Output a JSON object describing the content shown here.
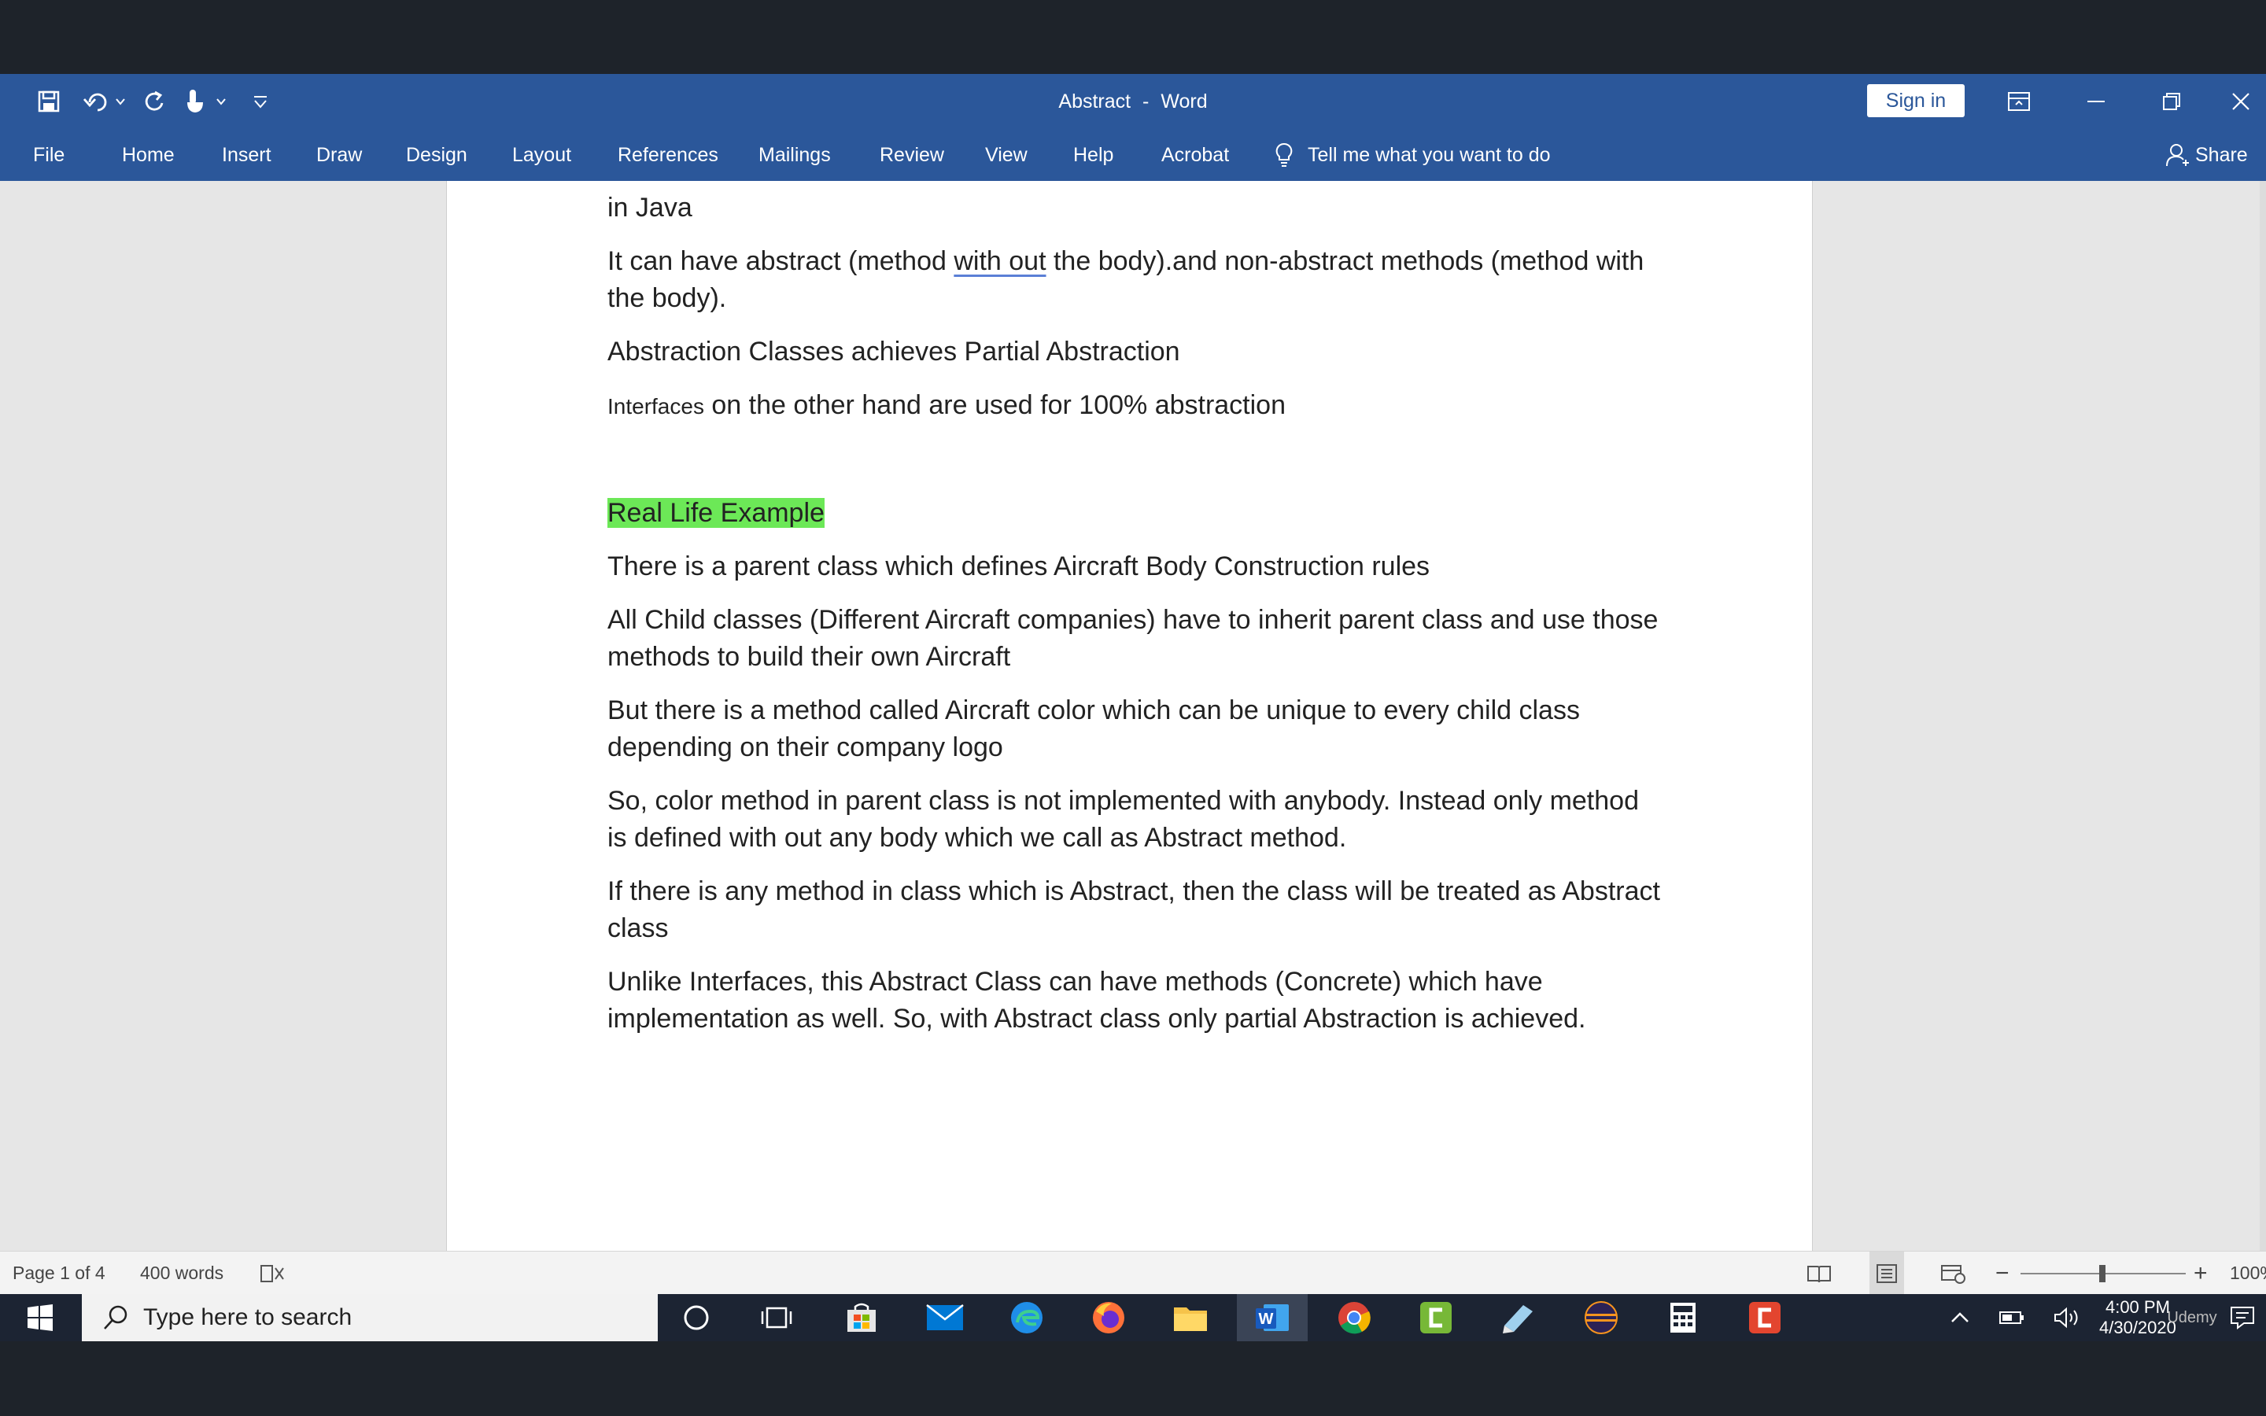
{
  "window": {
    "doc_name": "Abstract",
    "separator": "-",
    "app_name": "Word",
    "sign_in_label": "Sign in"
  },
  "ribbon": {
    "tabs": [
      "File",
      "Home",
      "Insert",
      "Draw",
      "Design",
      "Layout",
      "References",
      "Mailings",
      "Review",
      "View",
      "Help",
      "Acrobat"
    ],
    "tell_me": "Tell me what you want to do",
    "share": "Share"
  },
  "document": {
    "cut_top": "in Java",
    "p1_before": "It can have abstract (method ",
    "p1_link": "with out",
    "p1_after": " the body).and non-abstract methods (method with the body).",
    "p2": "Abstraction Classes achieves Partial Abstraction",
    "p3_small": "Interfaces",
    "p3_rest": " on the other hand are used for 100% abstraction",
    "heading": "Real Life Example",
    "p4": "There is a parent class which defines Aircraft Body Construction rules",
    "p5": "All Child classes (Different Aircraft companies) have to inherit parent class and use those methods to build their own Aircraft",
    "p6": "But there is a method called Aircraft color which can be unique to every child class depending on their company logo",
    "p7": "So, color method in parent class is not implemented with anybody. Instead only method is defined with out any body which we call as Abstract method.",
    "p8": "If there is any method in class which is Abstract, then the class will be treated as Abstract class",
    "p9": "Unlike Interfaces, this Abstract Class can have methods (Concrete) which have implementation as well. So, with Abstract class only partial Abstraction is achieved."
  },
  "status": {
    "page": "Page 1 of 4",
    "words": "400 words",
    "zoom": "100%"
  },
  "taskbar": {
    "search_placeholder": "Type here to search",
    "time": "4:00 PM",
    "date": "4/30/2020",
    "watermark": "Udemy"
  },
  "colors": {
    "word_blue": "#2b579a",
    "highlight": "#6ce857",
    "taskbar": "#1c2433"
  }
}
